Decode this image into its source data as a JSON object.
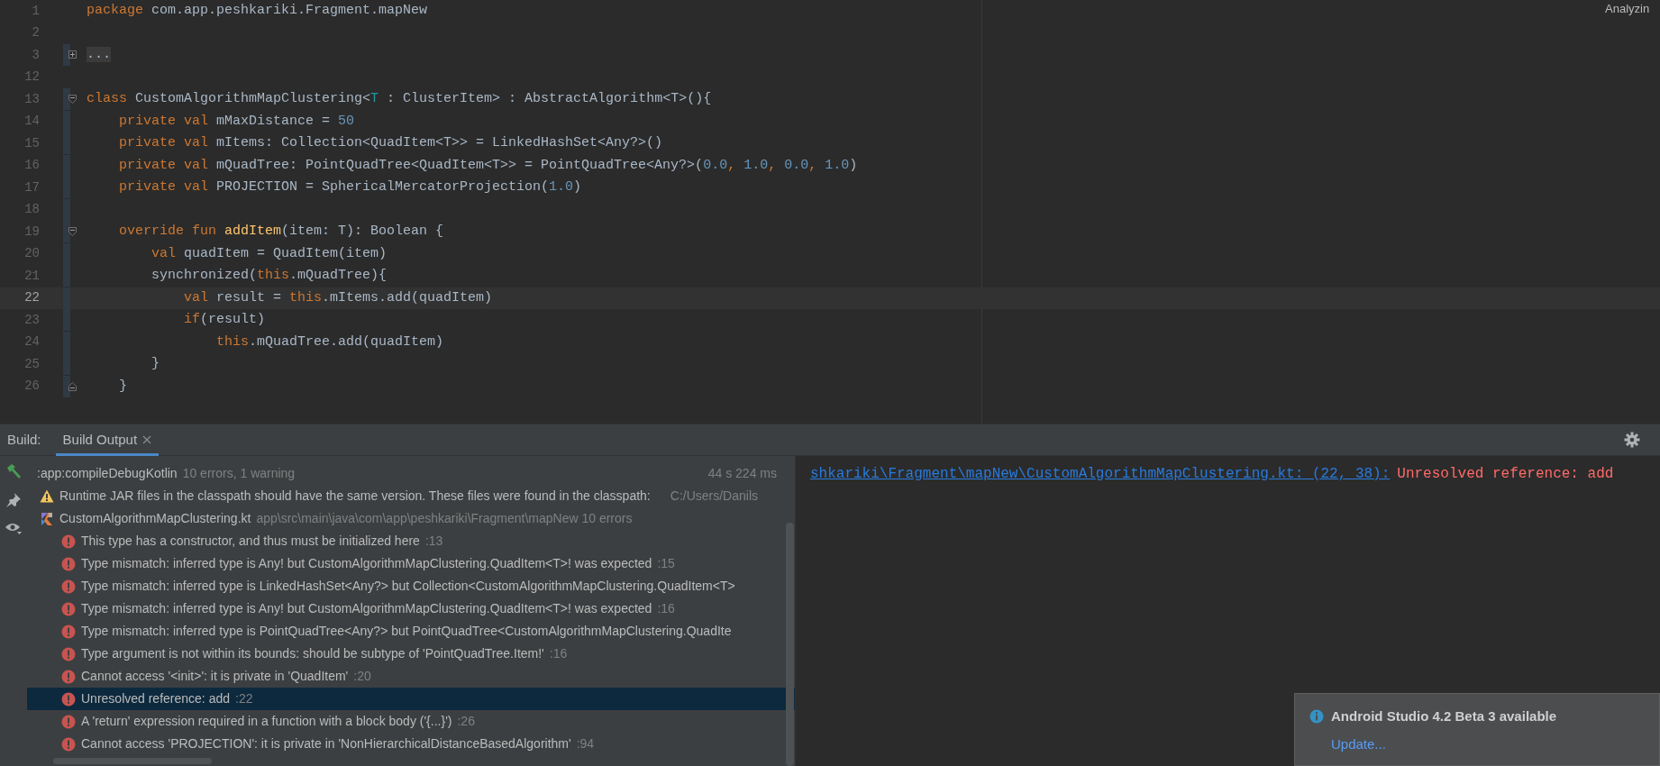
{
  "editor": {
    "status": "Analyzin",
    "lines": [
      {
        "number": "1",
        "current": false,
        "changed": false,
        "tokens": [
          {
            "text": "package",
            "kind": "keyword"
          },
          {
            "text": " com.app.peshkariki.Fragment.mapNew",
            "kind": "plain"
          }
        ]
      },
      {
        "number": "2",
        "current": false,
        "changed": false
      },
      {
        "number": "3",
        "current": false,
        "changed": true,
        "fold": {
          "kind": "collapsed"
        },
        "tokens": [
          {
            "text": "...",
            "kind": "folded"
          }
        ]
      },
      {
        "number": "12",
        "current": false,
        "changed": false
      },
      {
        "number": "13",
        "current": false,
        "changed": true,
        "fold": {
          "kind": "open"
        },
        "tokens": [
          {
            "text": "class",
            "kind": "keyword"
          },
          {
            "text": " CustomAlgorithmMapClustering<",
            "kind": "plain"
          },
          {
            "text": "T",
            "kind": "type_param"
          },
          {
            "text": " : ClusterItem> : AbstractAlgorithm<T>(){",
            "kind": "plain"
          }
        ]
      },
      {
        "number": "14",
        "current": false,
        "changed": true,
        "tokens": [
          {
            "text": "    private val",
            "kind": "keyword"
          },
          {
            "text": " mMaxDistance = ",
            "kind": "plain"
          },
          {
            "text": "50",
            "kind": "number"
          }
        ]
      },
      {
        "number": "15",
        "current": false,
        "changed": true,
        "tokens": [
          {
            "text": "    private val",
            "kind": "keyword"
          },
          {
            "text": " mItems: Collection<QuadItem<T>> = LinkedHashSet<Any?>()",
            "kind": "plain"
          }
        ]
      },
      {
        "number": "16",
        "current": false,
        "changed": true,
        "tokens": [
          {
            "text": "    private val",
            "kind": "keyword"
          },
          {
            "text": " mQuadTree: PointQuadTree<QuadItem<T>> = PointQuadTree<Any?>(",
            "kind": "plain"
          },
          {
            "text": "0.0",
            "kind": "number"
          },
          {
            "text": ", ",
            "kind": "keyword"
          },
          {
            "text": "1.0",
            "kind": "number"
          },
          {
            "text": ", ",
            "kind": "keyword"
          },
          {
            "text": "0.0",
            "kind": "number"
          },
          {
            "text": ", ",
            "kind": "keyword"
          },
          {
            "text": "1.0",
            "kind": "number"
          },
          {
            "text": ")",
            "kind": "plain"
          }
        ]
      },
      {
        "number": "17",
        "current": false,
        "changed": true,
        "tokens": [
          {
            "text": "    private val",
            "kind": "keyword"
          },
          {
            "text": " PROJECTION = SphericalMercatorProjection(",
            "kind": "plain"
          },
          {
            "text": "1.0",
            "kind": "number"
          },
          {
            "text": ")",
            "kind": "plain"
          }
        ]
      },
      {
        "number": "18",
        "current": false,
        "changed": true
      },
      {
        "number": "19",
        "current": false,
        "changed": true,
        "fold": {
          "kind": "open"
        },
        "tokens": [
          {
            "text": "    override fun ",
            "kind": "keyword"
          },
          {
            "text": "addItem",
            "kind": "function"
          },
          {
            "text": "(item: T): Boolean {",
            "kind": "plain"
          }
        ]
      },
      {
        "number": "20",
        "current": false,
        "changed": true,
        "tokens": [
          {
            "text": "        val",
            "kind": "keyword"
          },
          {
            "text": " quadItem = QuadItem(item)",
            "kind": "plain"
          }
        ]
      },
      {
        "number": "21",
        "current": false,
        "changed": true,
        "tokens": [
          {
            "text": "        synchronized(",
            "kind": "plain"
          },
          {
            "text": "this",
            "kind": "keyword"
          },
          {
            "text": ".mQuadTree){",
            "kind": "plain"
          }
        ]
      },
      {
        "number": "22",
        "current": true,
        "changed": true,
        "tokens": [
          {
            "text": "            val",
            "kind": "keyword"
          },
          {
            "text": " result = ",
            "kind": "plain"
          },
          {
            "text": "this",
            "kind": "keyword"
          },
          {
            "text": ".mItems.add(quadItem)",
            "kind": "plain"
          }
        ]
      },
      {
        "number": "23",
        "current": false,
        "changed": true,
        "tokens": [
          {
            "text": "            if",
            "kind": "keyword"
          },
          {
            "text": "(result)",
            "kind": "plain"
          }
        ]
      },
      {
        "number": "24",
        "current": false,
        "changed": true,
        "tokens": [
          {
            "text": "                this",
            "kind": "keyword"
          },
          {
            "text": ".mQuadTree.add(quadItem)",
            "kind": "plain"
          }
        ]
      },
      {
        "number": "25",
        "current": false,
        "changed": true,
        "tokens": [
          {
            "text": "        }",
            "kind": "plain"
          }
        ]
      },
      {
        "number": "26",
        "current": false,
        "changed": true,
        "fold": {
          "kind": "end"
        },
        "tokens": [
          {
            "text": "    }",
            "kind": "plain"
          }
        ]
      }
    ]
  },
  "build_panel": {
    "label": "Build:",
    "tabs": [
      {
        "label": "Build Output",
        "selected": true
      }
    ],
    "tree": [
      {
        "kind": "task",
        "text": ":app:compileDebugKotlin",
        "detail": "10 errors, 1 warning",
        "time": "44 s 224 ms",
        "selected": false,
        "children": [
          {
            "kind": "warning",
            "text": "Runtime JAR files in the classpath should have the same version. These files were found in the classpath:",
            "detail": "C:/Users/Danils",
            "selected": false
          },
          {
            "kind": "file",
            "text": "CustomAlgorithmMapClustering.kt",
            "detail": "app\\src\\main\\java\\com\\app\\peshkariki\\Fragment\\mapNew 10 errors",
            "selected": false,
            "children": [
              {
                "kind": "error",
                "text": "This type has a constructor, and thus must be initialized here",
                "detail": ":13",
                "selected": false
              },
              {
                "kind": "error",
                "text": "Type mismatch: inferred type is Any! but CustomAlgorithmMapClustering.QuadItem<T>! was expected",
                "detail": ":15",
                "selected": false
              },
              {
                "kind": "error",
                "text": "Type mismatch: inferred type is LinkedHashSet<Any?> but Collection<CustomAlgorithmMapClustering.QuadItem<T>",
                "selected": false
              },
              {
                "kind": "error",
                "text": "Type mismatch: inferred type is Any! but CustomAlgorithmMapClustering.QuadItem<T>! was expected",
                "detail": ":16",
                "selected": false
              },
              {
                "kind": "error",
                "text": "Type mismatch: inferred type is PointQuadTree<Any?> but PointQuadTree<CustomAlgorithmMapClustering.QuadIte",
                "selected": false
              },
              {
                "kind": "error",
                "text": "Type argument is not within its bounds: should be subtype of 'PointQuadTree.Item!'",
                "detail": ":16",
                "selected": false
              },
              {
                "kind": "error",
                "text": "Cannot access '<init>': it is private in 'QuadItem'",
                "detail": ":20",
                "selected": false
              },
              {
                "kind": "error",
                "text": "Unresolved reference: add",
                "detail": ":22",
                "selected": true
              },
              {
                "kind": "error",
                "text": "A 'return' expression required in a function with a block body ('{...}')",
                "detail": ":26",
                "selected": false
              },
              {
                "kind": "error",
                "text": "Cannot access 'PROJECTION': it is private in 'NonHierarchicalDistanceBasedAlgorithm'",
                "detail": ":94",
                "selected": false
              }
            ]
          }
        ]
      }
    ],
    "console": {
      "link": "shkariki\\Fragment\\mapNew\\CustomAlgorithmMapClustering.kt: (22, 38):",
      "message": "Unresolved reference: add"
    }
  },
  "notification": {
    "title": "Android Studio 4.2 Beta 3 available",
    "action": "Update..."
  }
}
